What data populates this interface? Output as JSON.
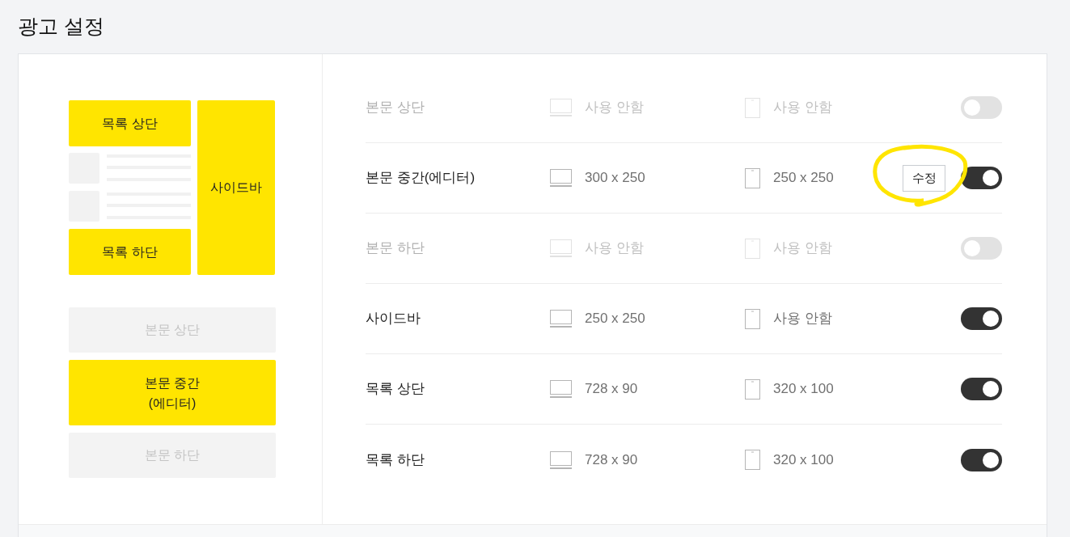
{
  "page": {
    "title": "광고 설정"
  },
  "preview": {
    "list_top": {
      "label": "목록 상단",
      "on": true
    },
    "list_bottom": {
      "label": "목록 하단",
      "on": true
    },
    "sidebar": {
      "label": "사이드바",
      "on": true
    },
    "body_slots": [
      {
        "label": "본문 상단",
        "on": false
      },
      {
        "label": "본문 중간\n(에디터)",
        "on": true
      },
      {
        "label": "본문 하단",
        "on": false
      }
    ]
  },
  "rows": [
    {
      "name": "본문 상단",
      "enabled": false,
      "pc": "사용 안함",
      "mobile": "사용 안함"
    },
    {
      "name": "본문 중간(에디터)",
      "enabled": true,
      "pc": "300 x 250",
      "mobile": "250 x 250",
      "edit_button": {
        "label": "수정",
        "highlighted": true
      }
    },
    {
      "name": "본문 하단",
      "enabled": false,
      "pc": "사용 안함",
      "mobile": "사용 안함"
    },
    {
      "name": "사이드바",
      "enabled": true,
      "pc": "250 x 250",
      "mobile": "사용 안함"
    },
    {
      "name": "목록 상단",
      "enabled": true,
      "pc": "728 x 90",
      "mobile": "320 x 100"
    },
    {
      "name": "목록 하단",
      "enabled": true,
      "pc": "728 x 90",
      "mobile": "320 x 100"
    }
  ]
}
